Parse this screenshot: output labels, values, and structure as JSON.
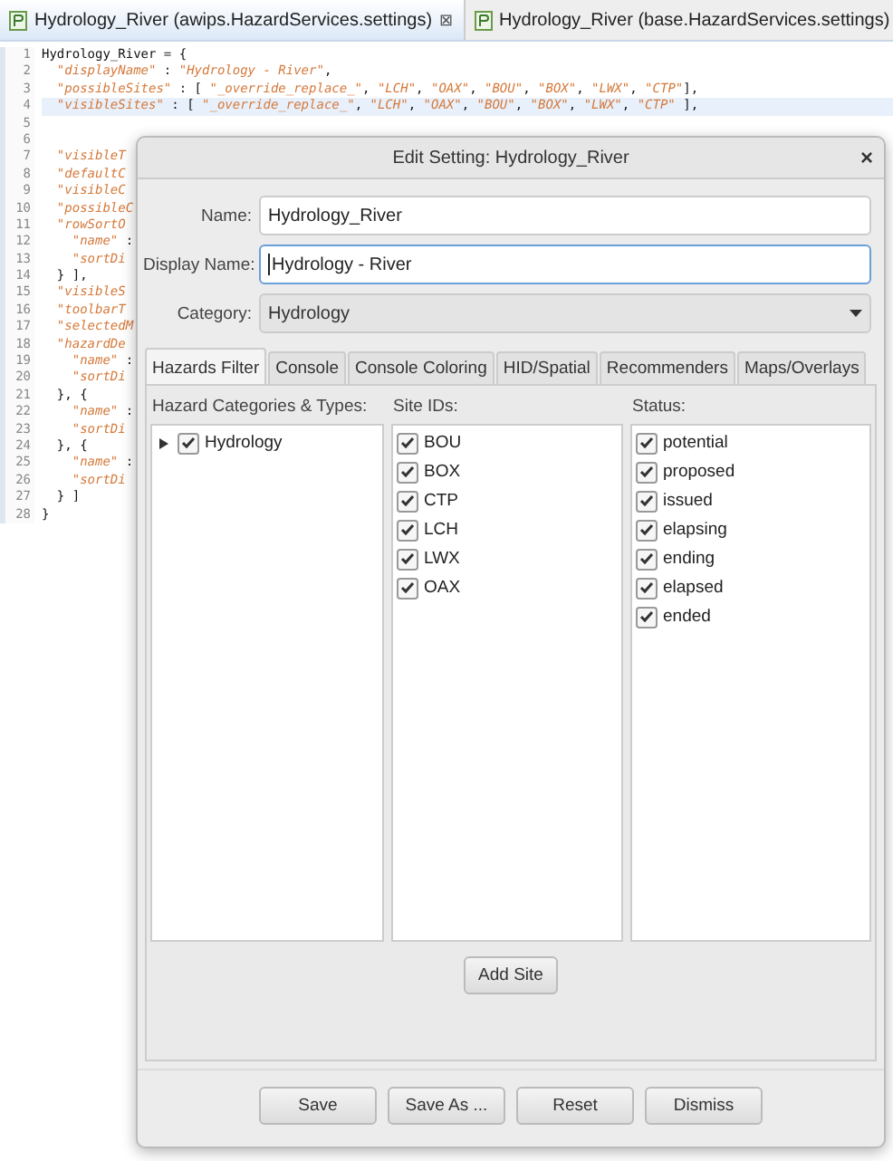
{
  "editor_tabs": [
    {
      "label": "Hydrology_River (awips.HazardServices.settings)",
      "selected": true,
      "close": "⊠"
    },
    {
      "label": "Hydrology_River (base.HazardServices.settings)",
      "selected": false
    }
  ],
  "code_lines": [
    {
      "number": "1",
      "tokens": [
        {
          "kind": "plain",
          "text": "Hydrology_River = {"
        }
      ]
    },
    {
      "number": "2",
      "tokens": [
        {
          "kind": "string",
          "text": "  \"displayName\""
        },
        {
          "kind": "plain",
          "text": " : "
        },
        {
          "kind": "string",
          "text": "\"Hydrology - River\""
        },
        {
          "kind": "plain",
          "text": ","
        }
      ]
    },
    {
      "number": "3",
      "tokens": [
        {
          "kind": "string",
          "text": "  \"possibleSites\""
        },
        {
          "kind": "plain",
          "text": " : [ "
        },
        {
          "kind": "string",
          "text": "\"_override_replace_\""
        },
        {
          "kind": "plain",
          "text": ", "
        },
        {
          "kind": "string",
          "text": "\"LCH\""
        },
        {
          "kind": "plain",
          "text": ", "
        },
        {
          "kind": "string",
          "text": "\"OAX\""
        },
        {
          "kind": "plain",
          "text": ", "
        },
        {
          "kind": "string",
          "text": "\"BOU\""
        },
        {
          "kind": "plain",
          "text": ", "
        },
        {
          "kind": "string",
          "text": "\"BOX\""
        },
        {
          "kind": "plain",
          "text": ", "
        },
        {
          "kind": "string",
          "text": "\"LWX\""
        },
        {
          "kind": "plain",
          "text": ", "
        },
        {
          "kind": "string",
          "text": "\"CTP\""
        },
        {
          "kind": "plain",
          "text": "],"
        }
      ]
    },
    {
      "number": "4",
      "highlighted": true,
      "tokens": [
        {
          "kind": "string",
          "text": "  \"visibleSites\""
        },
        {
          "kind": "plain",
          "text": " : [ "
        },
        {
          "kind": "string",
          "text": "\"_override_replace_\""
        },
        {
          "kind": "plain",
          "text": ", "
        },
        {
          "kind": "string",
          "text": "\"LCH\""
        },
        {
          "kind": "plain",
          "text": ", "
        },
        {
          "kind": "string",
          "text": "\"OAX\""
        },
        {
          "kind": "plain",
          "text": ", "
        },
        {
          "kind": "string",
          "text": "\"BOU\""
        },
        {
          "kind": "plain",
          "text": ", "
        },
        {
          "kind": "string",
          "text": "\"BOX\""
        },
        {
          "kind": "plain",
          "text": ", "
        },
        {
          "kind": "string",
          "text": "\"LWX\""
        },
        {
          "kind": "plain",
          "text": ", "
        },
        {
          "kind": "string",
          "text": "\"CTP\""
        },
        {
          "kind": "plain",
          "text": " ],"
        }
      ]
    },
    {
      "number": "5"
    },
    {
      "number": "6"
    },
    {
      "number": "7",
      "tokens": [
        {
          "kind": "string",
          "text": "  \"visibleT"
        }
      ]
    },
    {
      "number": "8",
      "tokens": [
        {
          "kind": "string",
          "text": "  \"defaultC"
        }
      ]
    },
    {
      "number": "9",
      "tokens": [
        {
          "kind": "string",
          "text": "  \"visibleC"
        }
      ]
    },
    {
      "number": "10",
      "tokens": [
        {
          "kind": "string",
          "text": "  \"possibleC"
        }
      ]
    },
    {
      "number": "11",
      "tokens": [
        {
          "kind": "string",
          "text": "  \"rowSortO"
        }
      ]
    },
    {
      "number": "12",
      "tokens": [
        {
          "kind": "string",
          "text": "    \"name\""
        },
        {
          "kind": "plain",
          "text": " :"
        }
      ]
    },
    {
      "number": "13",
      "tokens": [
        {
          "kind": "string",
          "text": "    \"sortDi"
        }
      ]
    },
    {
      "number": "14",
      "tokens": [
        {
          "kind": "plain",
          "text": "  } ],"
        }
      ]
    },
    {
      "number": "15",
      "tokens": [
        {
          "kind": "string",
          "text": "  \"visibleS"
        }
      ]
    },
    {
      "number": "16",
      "tokens": [
        {
          "kind": "string",
          "text": "  \"toolbarT"
        }
      ]
    },
    {
      "number": "17",
      "tokens": [
        {
          "kind": "string",
          "text": "  \"selectedM"
        }
      ]
    },
    {
      "number": "18",
      "tokens": [
        {
          "kind": "string",
          "text": "  \"hazardDe"
        }
      ]
    },
    {
      "number": "19",
      "tokens": [
        {
          "kind": "string",
          "text": "    \"name\""
        },
        {
          "kind": "plain",
          "text": " :"
        }
      ]
    },
    {
      "number": "20",
      "tokens": [
        {
          "kind": "string",
          "text": "    \"sortDi"
        }
      ]
    },
    {
      "number": "21",
      "tokens": [
        {
          "kind": "plain",
          "text": "  }, {"
        }
      ]
    },
    {
      "number": "22",
      "tokens": [
        {
          "kind": "string",
          "text": "    \"name\""
        },
        {
          "kind": "plain",
          "text": " :"
        }
      ]
    },
    {
      "number": "23",
      "tokens": [
        {
          "kind": "string",
          "text": "    \"sortDi"
        }
      ]
    },
    {
      "number": "24",
      "tokens": [
        {
          "kind": "plain",
          "text": "  }, {"
        }
      ]
    },
    {
      "number": "25",
      "tokens": [
        {
          "kind": "string",
          "text": "    \"name\""
        },
        {
          "kind": "plain",
          "text": " :"
        }
      ]
    },
    {
      "number": "26",
      "tokens": [
        {
          "kind": "string",
          "text": "    \"sortDi"
        }
      ]
    },
    {
      "number": "27",
      "tokens": [
        {
          "kind": "plain",
          "text": "  } ]"
        }
      ]
    },
    {
      "number": "28",
      "tokens": [
        {
          "kind": "plain",
          "text": "}"
        }
      ]
    }
  ],
  "dialog": {
    "title": "Edit Setting: Hydrology_River",
    "close": "×",
    "fields": [
      {
        "kind": "text",
        "label": "Name:",
        "value": "Hydrology_River"
      },
      {
        "kind": "text",
        "label": "Display Name:",
        "value": "Hydrology - River",
        "focused": true
      },
      {
        "kind": "select",
        "label": "Category:",
        "value": "Hydrology"
      }
    ],
    "tabs": [
      {
        "label": "Hazards Filter",
        "selected": true
      },
      {
        "label": "Console",
        "selected": false
      },
      {
        "label": "Console Coloring",
        "selected": false
      },
      {
        "label": "HID/Spatial",
        "selected": false
      },
      {
        "label": "Recommenders",
        "selected": false
      },
      {
        "label": "Maps/Overlays",
        "selected": false
      }
    ],
    "hazard_categories": {
      "header": "Hazard Categories & Types:",
      "items": [
        {
          "label": "Hydrology",
          "checked": true,
          "expanded": false
        }
      ]
    },
    "site_ids": {
      "header": "Site IDs:",
      "items": [
        {
          "label": "BOU",
          "checked": true
        },
        {
          "label": "BOX",
          "checked": true
        },
        {
          "label": "CTP",
          "checked": true
        },
        {
          "label": "LCH",
          "checked": true
        },
        {
          "label": "LWX",
          "checked": true
        },
        {
          "label": "OAX",
          "checked": true
        }
      ]
    },
    "status": {
      "header": "Status:",
      "items": [
        {
          "label": "potential",
          "checked": true
        },
        {
          "label": "proposed",
          "checked": true
        },
        {
          "label": "issued",
          "checked": true
        },
        {
          "label": "elapsing",
          "checked": true
        },
        {
          "label": "ending",
          "checked": true
        },
        {
          "label": "elapsed",
          "checked": true
        },
        {
          "label": "ended",
          "checked": true
        }
      ]
    },
    "add_site_button": "Add Site",
    "buttons": [
      "Save",
      "Save As ...",
      "Reset",
      "Dismiss"
    ]
  }
}
